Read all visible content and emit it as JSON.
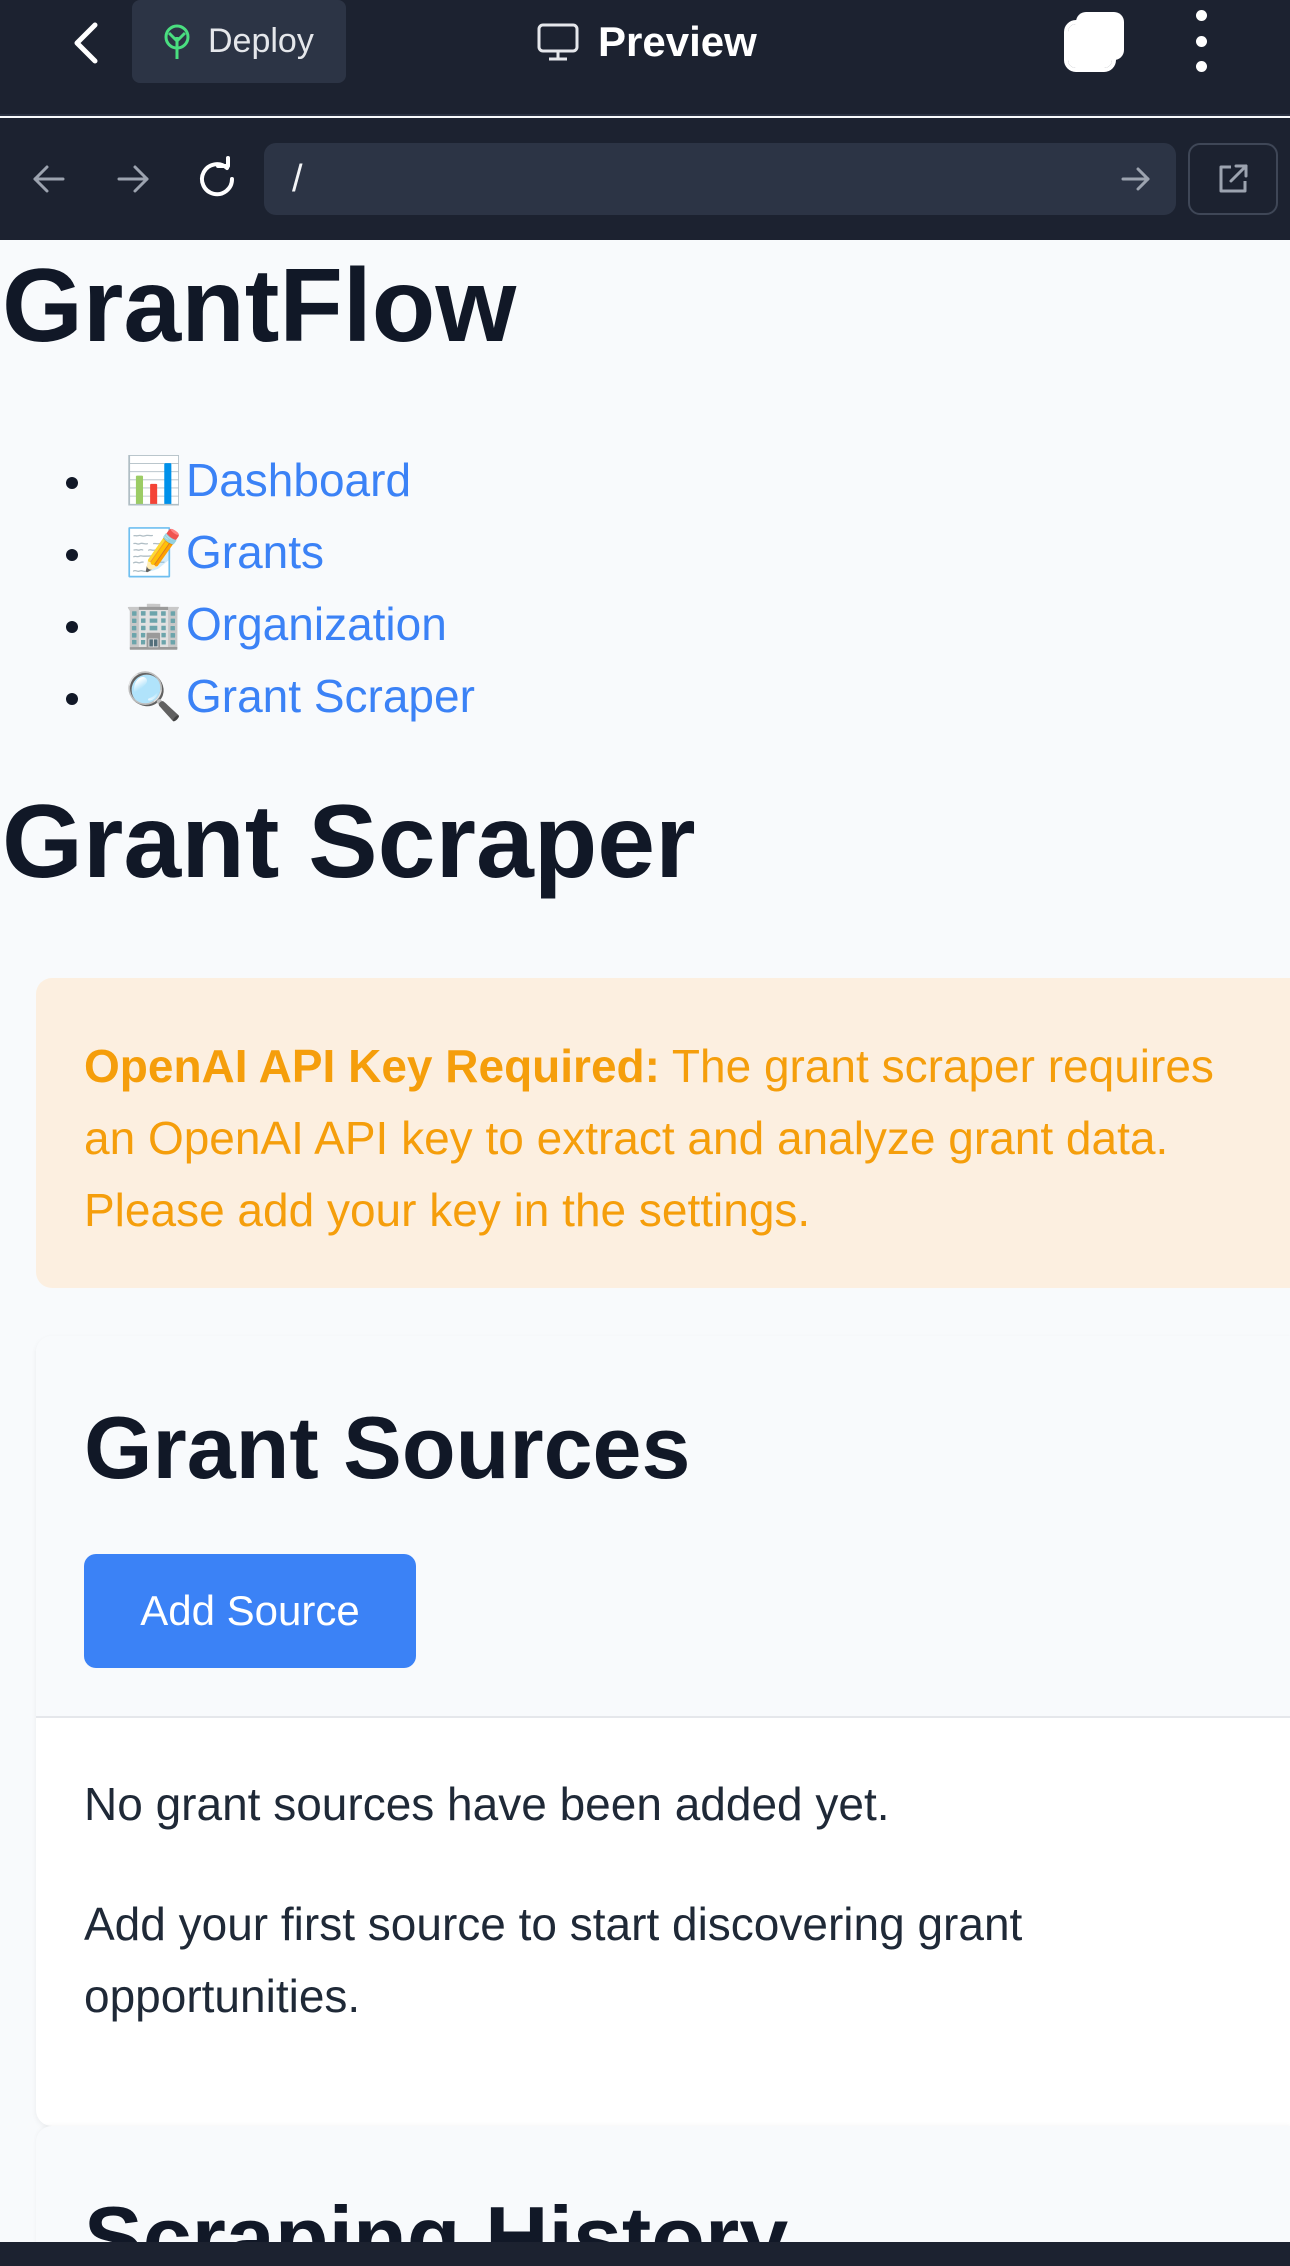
{
  "topbar": {
    "deploy_label": "Deploy",
    "preview_label": "Preview",
    "icons": [
      "chevron-left-icon",
      "deploy-icon",
      "monitor-icon",
      "tabs-icon",
      "more-vertical-icon"
    ]
  },
  "browser": {
    "url": "/",
    "icons": [
      "arrow-left-icon",
      "arrow-right-icon",
      "reload-icon",
      "go-arrow-icon",
      "external-link-icon"
    ]
  },
  "page": {
    "app_title": "GrantFlow",
    "nav": [
      {
        "emoji": "📊",
        "label": "Dashboard"
      },
      {
        "emoji": "📝",
        "label": "Grants"
      },
      {
        "emoji": "🏢",
        "label": "Organization"
      },
      {
        "emoji": "🔍",
        "label": "Grant Scraper"
      }
    ],
    "section_title": "Grant Scraper",
    "alert": {
      "strong": "OpenAI API Key Required:",
      "text": " The grant scraper requires an OpenAI API key to extract and analyze grant data. Please add your key in the settings."
    },
    "sources_card": {
      "title": "Grant Sources",
      "add_button": "Add Source",
      "empty_line_1": "No grant sources have been added yet.",
      "empty_line_2": "Add your first source to start discovering grant opportunities."
    },
    "history_card": {
      "title": "Scraping History"
    }
  },
  "colors": {
    "topbar_bg": "#1c2230",
    "link": "#3b82f6",
    "alert_bg": "#fcefe0",
    "alert_text": "#f59e0b",
    "primary_button": "#3b82f6"
  }
}
